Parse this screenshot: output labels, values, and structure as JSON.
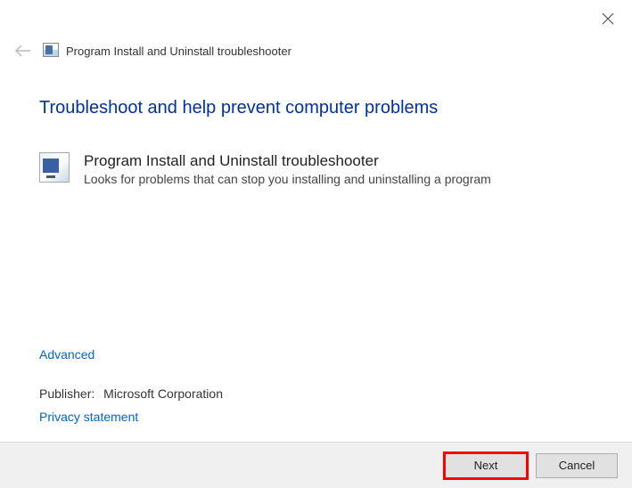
{
  "window": {
    "title": "Program Install and Uninstall troubleshooter"
  },
  "page": {
    "heading": "Troubleshoot and help prevent computer problems"
  },
  "troubleshooter": {
    "title": "Program Install and Uninstall troubleshooter",
    "description": "Looks for problems that can stop you installing and uninstalling a program"
  },
  "links": {
    "advanced": "Advanced",
    "privacy": "Privacy statement"
  },
  "publisher": {
    "label": "Publisher:",
    "value": "Microsoft Corporation"
  },
  "buttons": {
    "next": "Next",
    "cancel": "Cancel"
  }
}
